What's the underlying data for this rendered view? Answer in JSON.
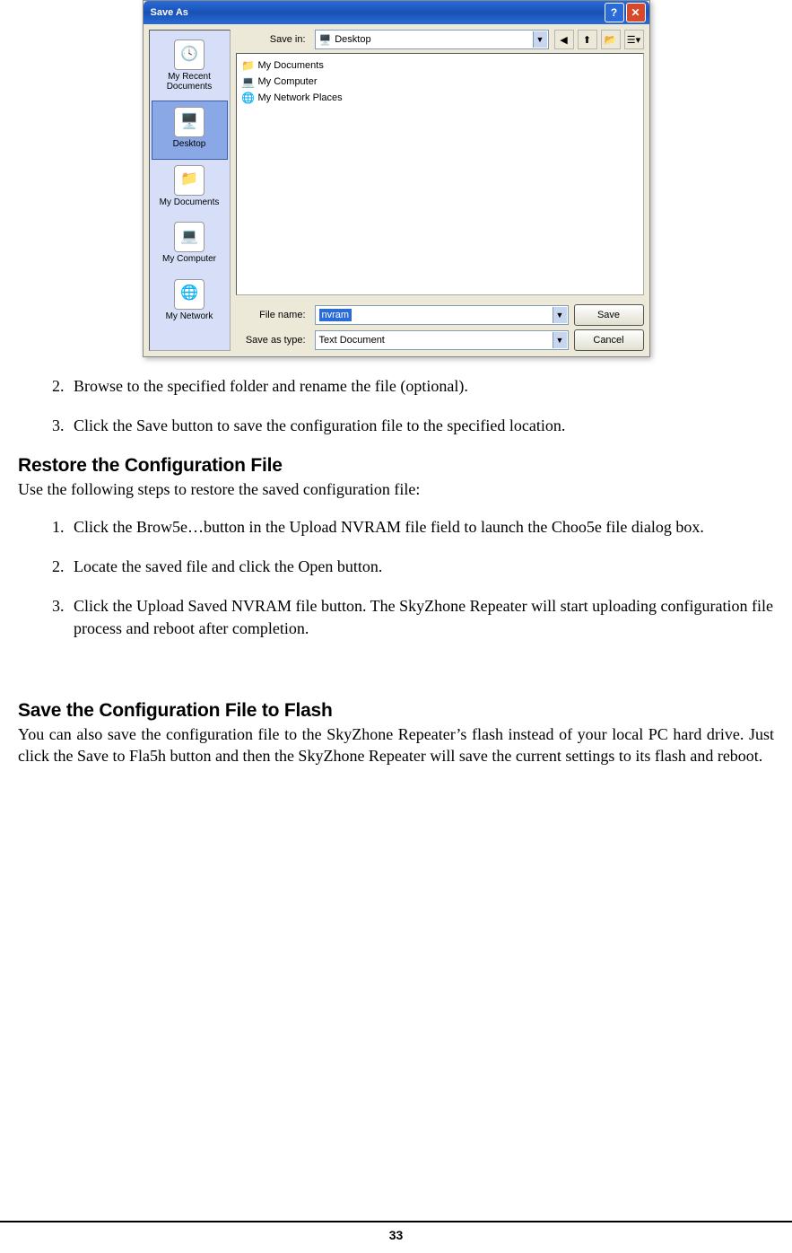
{
  "dialog": {
    "title": "Save As",
    "help_symbol": "?",
    "close_symbol": "✕",
    "save_in_label": "Save in:",
    "save_in_value": "Desktop",
    "toolbar_icons": [
      "back-icon",
      "up-icon",
      "new-folder-icon",
      "views-icon"
    ],
    "file_list": [
      {
        "icon": "📁",
        "label": "My Documents"
      },
      {
        "icon": "💻",
        "label": "My Computer"
      },
      {
        "icon": "🌐",
        "label": "My Network Places"
      }
    ],
    "sidebar": [
      {
        "icon": "📄",
        "label": "My Recent Documents"
      },
      {
        "icon": "🖥️",
        "label": "Desktop"
      },
      {
        "icon": "📁",
        "label": "My Documents"
      },
      {
        "icon": "💻",
        "label": "My Computer"
      },
      {
        "icon": "🌐",
        "label": "My Network"
      }
    ],
    "filename_label": "File name:",
    "filename_value": "nvram",
    "saveastype_label": "Save as type:",
    "saveastype_value": "Text Document",
    "save_button": "Save",
    "cancel_button": "Cancel"
  },
  "doc": {
    "step2": "Browse to the specified folder and rename the file (optional).",
    "step3": "Click the Save button to save the configuration file to the specified location.",
    "heading_restore": "Restore the Configuration File",
    "para_restore": "Use the following steps to restore the saved configuration file:",
    "restore_step1": "Click the Brow5e…button in the Upload NVRAM file field to launch the Choo5e file dialog box.",
    "restore_step2": "Locate the saved file and click the Open button.",
    "restore_step3": "Click the Upload Saved NVRAM file button.   The SkyZhone Repeater will start uploading configuration file process and reboot after completion.",
    "heading_flash": "Save the Configuration File to Flash",
    "para_flash": "You can also save the configuration file to the SkyZhone Repeater’s flash instead of your local PC hard drive. Just click the Save to Fla5h button and then the SkyZhone Repeater will save the current settings to its flash and reboot.",
    "page_number": "33"
  }
}
